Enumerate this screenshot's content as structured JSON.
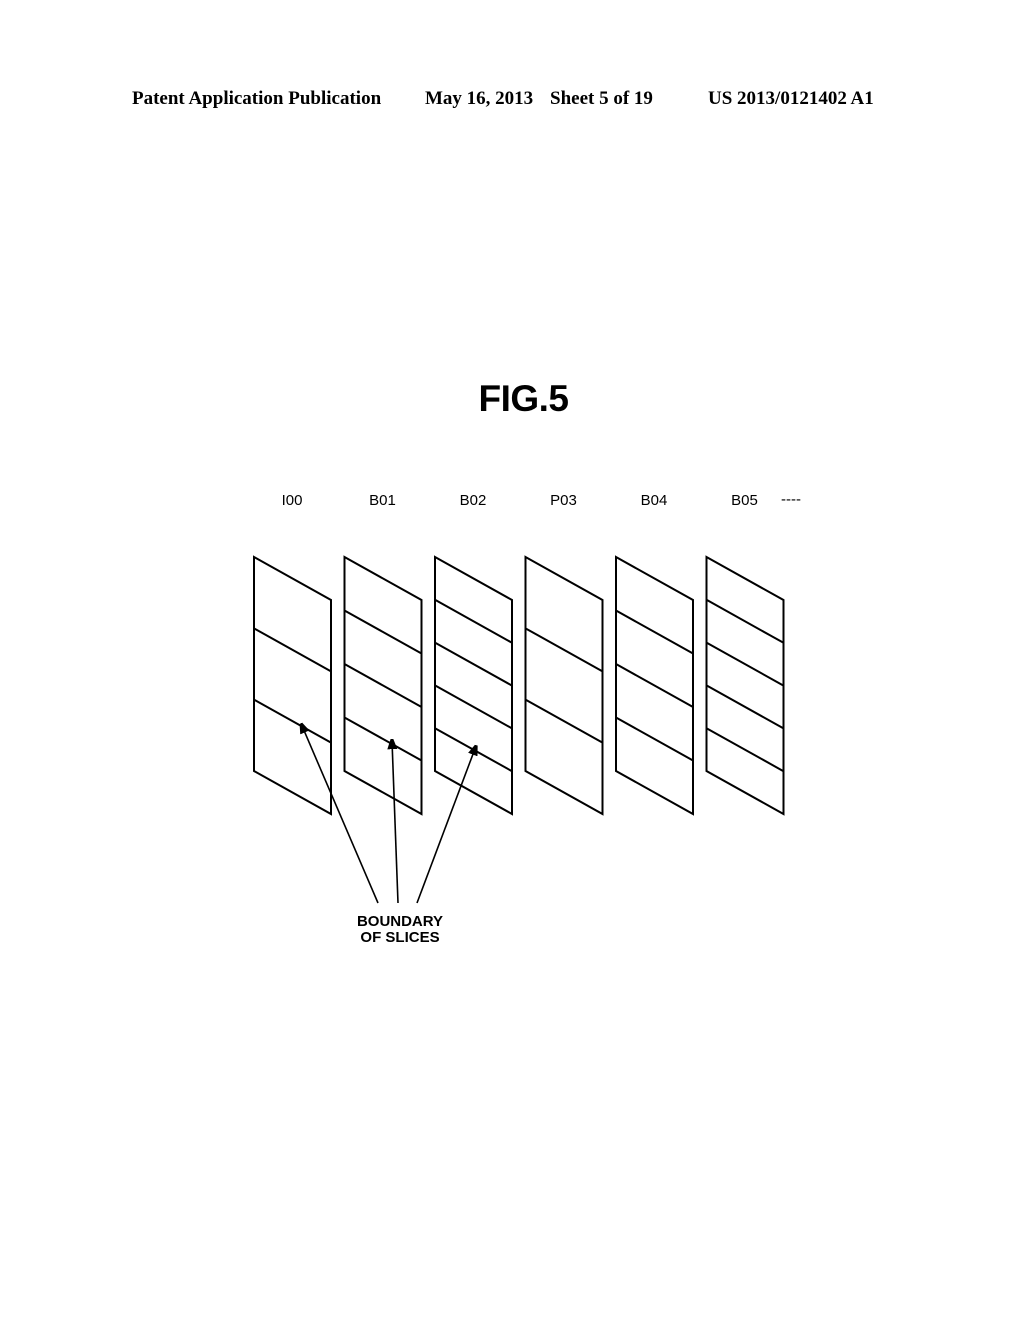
{
  "header": {
    "publication": "Patent Application Publication",
    "date": "May 16, 2013",
    "sheet": "Sheet 5 of 19",
    "number": "US 2013/0121402 A1"
  },
  "figure": {
    "title": "FIG.5",
    "frames": [
      {
        "label": "I00",
        "slices": 3
      },
      {
        "label": "B01",
        "slices": 4
      },
      {
        "label": "B02",
        "slices": 5
      },
      {
        "label": "P03",
        "slices": 3
      },
      {
        "label": "B04",
        "slices": 4
      },
      {
        "label": "B05",
        "slices": 5
      }
    ],
    "continuation": "----",
    "callout": {
      "lines": [
        "BOUNDARY",
        "OF SLICES"
      ],
      "points_to_frames": [
        "I00",
        "B01",
        "B02"
      ]
    }
  }
}
